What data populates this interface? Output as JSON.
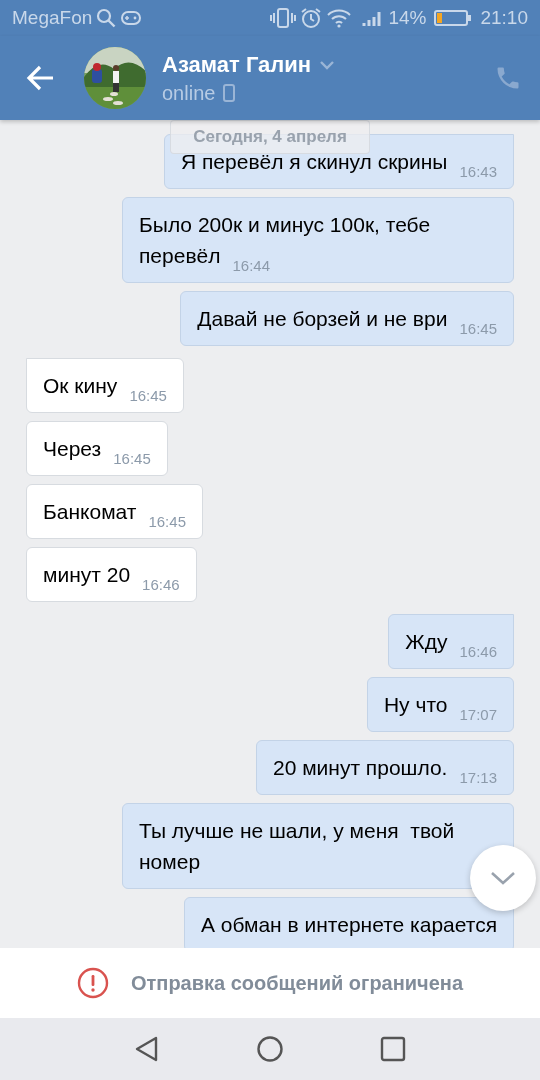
{
  "status_bar": {
    "carrier": "MegaFon",
    "battery": "14%",
    "time": "21:10"
  },
  "header": {
    "name": "Азамат Галин",
    "status": "online"
  },
  "date_label": "Сегодня, 4 апреля",
  "messages": [
    {
      "kind": "outgoing",
      "text": "Я перевёл я скинул скрины",
      "time": "16:43"
    },
    {
      "kind": "outgoing",
      "text": "Было 200к и минус 100к, тебе перевёл",
      "time": "16:44"
    },
    {
      "kind": "outgoing",
      "text": "Давай не борзей и не ври",
      "time": "16:45"
    },
    {
      "kind": "incoming",
      "text": "Ок кину",
      "time": "16:45"
    },
    {
      "kind": "incoming",
      "text": "Через",
      "time": "16:45"
    },
    {
      "kind": "incoming",
      "text": "Банкомат",
      "time": "16:45"
    },
    {
      "kind": "incoming",
      "text": "минут 20",
      "time": "16:46"
    },
    {
      "kind": "outgoing",
      "text": "Жду",
      "time": "16:46"
    },
    {
      "kind": "outgoing",
      "text": "Ну что",
      "time": "17:07"
    },
    {
      "kind": "outgoing",
      "text": "20 минут прошло.",
      "time": "17:13"
    },
    {
      "kind": "outgoing",
      "text": "Ты лучше не шали, у меня  твой номер"
    },
    {
      "kind": "outgoing",
      "text": "А обман в интернете карается"
    }
  ],
  "notice": "Отправка сообщений ограничена"
}
